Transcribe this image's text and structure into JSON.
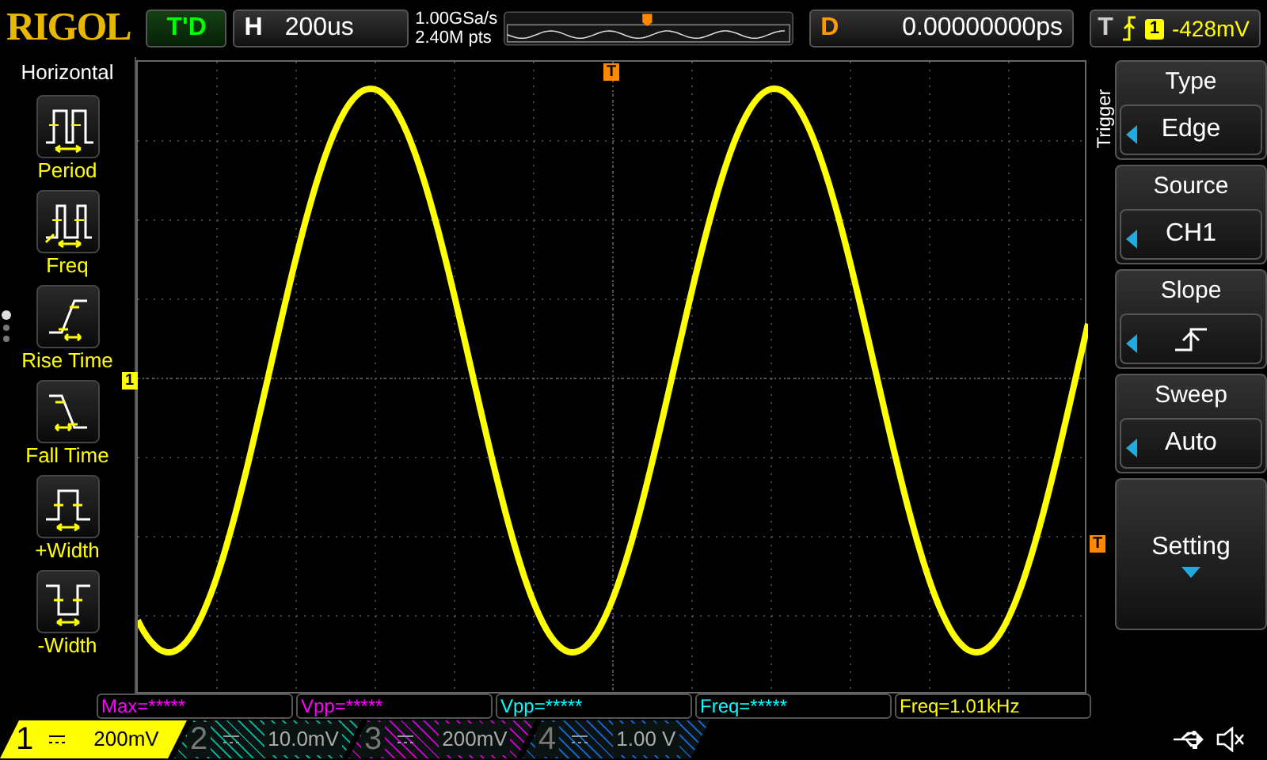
{
  "logo": "RIGOL",
  "run_status": "T'D",
  "horizontal": {
    "label": "H",
    "timebase": "200us"
  },
  "acquisition": {
    "sample_rate": "1.00GSa/s",
    "memory_depth": "2.40M pts"
  },
  "delay": {
    "label": "D",
    "value": "0.00000000ps"
  },
  "trigger_status": {
    "label": "T",
    "source": "1",
    "level": "-428mV"
  },
  "left_menu": {
    "title": "Horizontal",
    "items": [
      {
        "label": "Period",
        "kind": "period"
      },
      {
        "label": "Freq",
        "kind": "freq"
      },
      {
        "label": "Rise Time",
        "kind": "rise"
      },
      {
        "label": "Fall Time",
        "kind": "fall"
      },
      {
        "label": "+Width",
        "kind": "pwidth"
      },
      {
        "label": "-Width",
        "kind": "nwidth"
      }
    ],
    "pages": [
      {
        "selected": true
      },
      {
        "selected": false
      },
      {
        "selected": false
      }
    ]
  },
  "grid_markers": {
    "channel": "1",
    "trigger_position": "T",
    "trigger_level": "T"
  },
  "right_menu": {
    "title": "Trigger",
    "items": [
      {
        "label": "Type",
        "value": "Edge",
        "kind": "select"
      },
      {
        "label": "Source",
        "value": "CH1",
        "kind": "select"
      },
      {
        "label": "Slope",
        "kind": "slope"
      },
      {
        "label": "Sweep",
        "value": "Auto",
        "kind": "select"
      },
      {
        "label": "Setting",
        "kind": "submenu"
      }
    ]
  },
  "measurements": [
    {
      "text": "Max=*****",
      "color": "#ff00ff"
    },
    {
      "text": "Vpp=*****",
      "color": "#ff00ff"
    },
    {
      "text": "Vpp=*****",
      "color": "#00ffff"
    },
    {
      "text": "Freq=*****",
      "color": "#00ffff"
    },
    {
      "text": "Freq=1.01kHz",
      "color": "#ffff00"
    }
  ],
  "channels": [
    {
      "number": "1",
      "scale": "200mV",
      "color": "#ffff00",
      "selected": true
    },
    {
      "number": "2",
      "scale": "10.0mV",
      "color": "#00a890",
      "selected": false
    },
    {
      "number": "3",
      "scale": "200mV",
      "color": "#c000c0",
      "selected": false
    },
    {
      "number": "4",
      "scale": "1.00 V",
      "color": "#1060c0",
      "selected": false
    }
  ]
}
